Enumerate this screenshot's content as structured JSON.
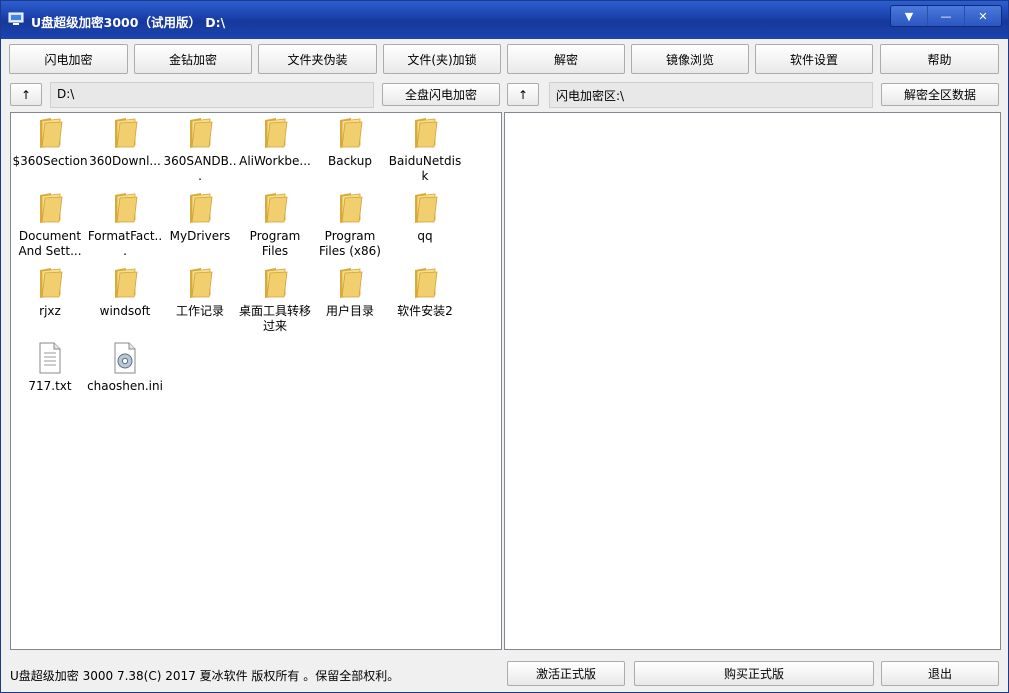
{
  "window": {
    "title": "U盘超级加密3000（试用版）  D:\\",
    "controls": [
      "▼",
      "—",
      "✕"
    ]
  },
  "toolbar": {
    "buttons": [
      "闪电加密",
      "金钻加密",
      "文件夹伪装",
      "文件(夹)加锁",
      "解密",
      "镜像浏览",
      "软件设置",
      "帮助"
    ]
  },
  "left_pane": {
    "up_label": "↑",
    "path": "D:\\",
    "action_label": "全盘闪电加密",
    "items": [
      {
        "name": "$360Section",
        "type": "folder"
      },
      {
        "name": "360Downl...",
        "type": "folder"
      },
      {
        "name": "360SANDB...",
        "type": "folder"
      },
      {
        "name": "AliWorkbe...",
        "type": "folder"
      },
      {
        "name": "Backup",
        "type": "folder"
      },
      {
        "name": "BaiduNetdisk",
        "type": "folder"
      },
      {
        "name": "Document And Sett...",
        "type": "folder"
      },
      {
        "name": "FormatFact...",
        "type": "folder"
      },
      {
        "name": "MyDrivers",
        "type": "folder"
      },
      {
        "name": "Program Files",
        "type": "folder"
      },
      {
        "name": "Program Files (x86)",
        "type": "folder"
      },
      {
        "name": "qq",
        "type": "folder"
      },
      {
        "name": "rjxz",
        "type": "folder"
      },
      {
        "name": "windsoft",
        "type": "folder"
      },
      {
        "name": "工作记录",
        "type": "folder"
      },
      {
        "name": "桌面工具转移过来",
        "type": "folder"
      },
      {
        "name": "用户目录",
        "type": "folder"
      },
      {
        "name": "软件安装2",
        "type": "folder"
      },
      {
        "name": "717.txt",
        "type": "txt"
      },
      {
        "name": "chaoshen.ini",
        "type": "ini"
      }
    ]
  },
  "right_pane": {
    "up_label": "↑",
    "path": "闪电加密区:\\",
    "action_label": "解密全区数据"
  },
  "status_bar": {
    "text": "U盘超级加密 3000 7.38(C) 2017 夏冰软件 版权所有 。保留全部权利。",
    "activate_label": "激活正式版",
    "buy_label": "购买正式版",
    "exit_label": "退出"
  },
  "colors": {
    "titlebar": "#1a3fa8",
    "folder": "#f1cf6e"
  }
}
